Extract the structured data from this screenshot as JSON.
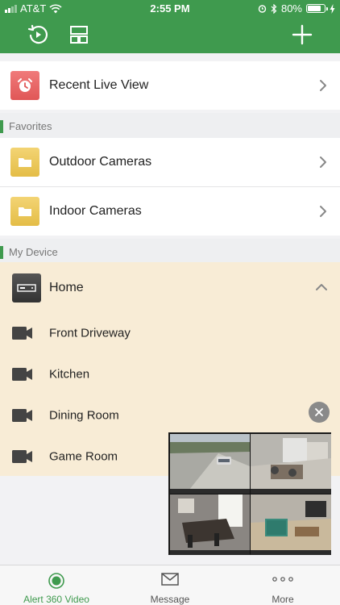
{
  "status_bar": {
    "carrier": "AT&T",
    "time": "2:55 PM",
    "battery": "80%",
    "battery_level": 0.8
  },
  "toolbar": {
    "icons": [
      "playback-icon",
      "layout-icon",
      "add-icon"
    ]
  },
  "recent": {
    "label": "Recent Live View"
  },
  "favorites": {
    "title": "Favorites",
    "items": [
      {
        "label": "Outdoor Cameras"
      },
      {
        "label": "Indoor Cameras"
      }
    ]
  },
  "my_device": {
    "title": "My Device",
    "device": {
      "label": "Home"
    },
    "cameras": [
      {
        "label": "Front Driveway"
      },
      {
        "label": "Kitchen"
      },
      {
        "label": "Dining Room"
      },
      {
        "label": "Game Room"
      }
    ]
  },
  "tabbar": {
    "tabs": [
      {
        "label": "Alert 360 Video",
        "active": true
      },
      {
        "label": "Message",
        "active": false
      },
      {
        "label": "More",
        "active": false
      }
    ]
  },
  "colors": {
    "brand_green": "#3f9a4e",
    "device_bg": "#f8ecd6",
    "folder_yellow": "#e8c252",
    "recent_red": "#e36060"
  }
}
